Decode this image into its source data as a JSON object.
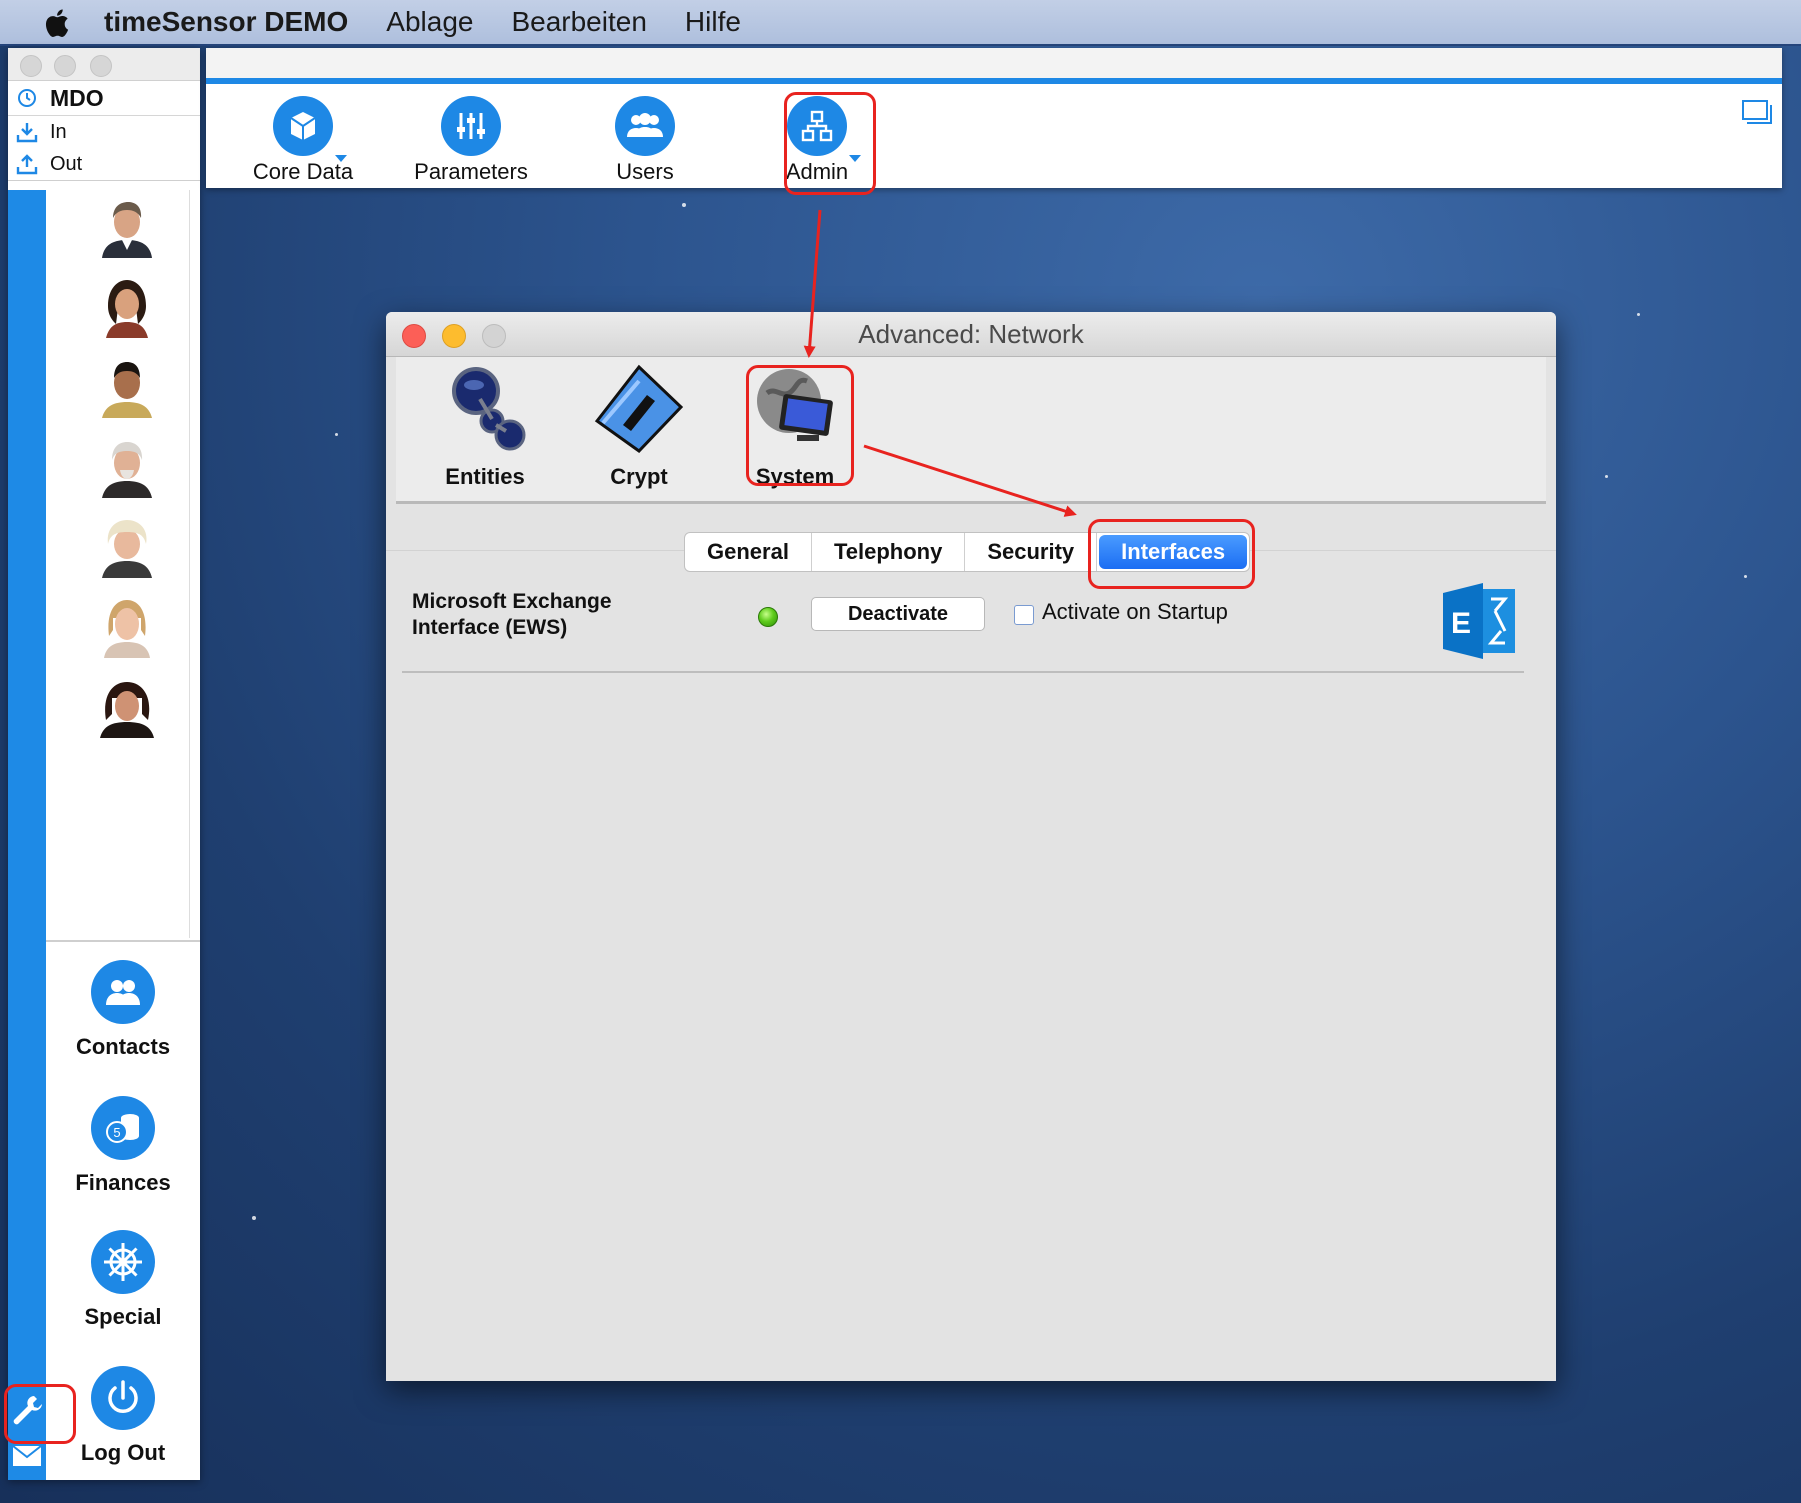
{
  "menubar": {
    "app_name": "timeSensor DEMO",
    "items": [
      "Ablage",
      "Bearbeiten",
      "Hilfe"
    ]
  },
  "sidebar": {
    "header": "MDO",
    "in_label": "In",
    "out_label": "Out",
    "modules": [
      {
        "label": "Contacts",
        "icon": "contacts-icon"
      },
      {
        "label": "Finances",
        "icon": "finances-icon"
      },
      {
        "label": "Special",
        "icon": "special-icon"
      },
      {
        "label": "Log Out",
        "icon": "power-icon"
      }
    ]
  },
  "toolbar": {
    "items": [
      {
        "label": "Core Data",
        "icon": "cube-icon"
      },
      {
        "label": "Parameters",
        "icon": "sliders-icon"
      },
      {
        "label": "Users",
        "icon": "users-icon"
      },
      {
        "label": "Admin",
        "icon": "hierarchy-icon"
      }
    ]
  },
  "dialog": {
    "title": "Advanced: Network",
    "tools": [
      {
        "label": "Entities",
        "icon": "entities-icon"
      },
      {
        "label": "Crypt",
        "icon": "crypt-icon"
      },
      {
        "label": "System",
        "icon": "system-icon"
      }
    ],
    "tabs": [
      "General",
      "Telephony",
      "Security",
      "Interfaces"
    ],
    "active_tab": "Interfaces",
    "interface": {
      "name": "Microsoft Exchange\nInterface (EWS)",
      "status": "active",
      "button_label": "Deactivate",
      "checkbox_label": "Activate on Startup",
      "checkbox_checked": false
    }
  },
  "colors": {
    "accent": "#1e88e5",
    "highlight": "#e8231f"
  }
}
